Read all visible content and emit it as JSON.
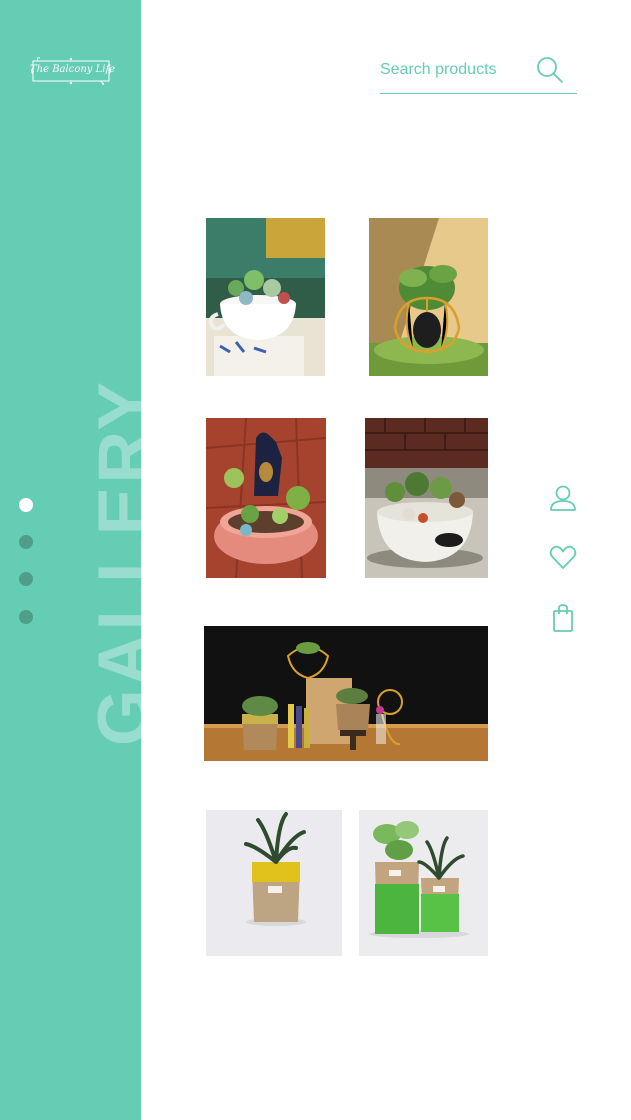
{
  "brand": {
    "logo_text": "The Balcony Life"
  },
  "sidebar": {
    "gallery_label": "GALLERY",
    "pager": [
      {
        "state": "active"
      },
      {
        "state": "inactive"
      },
      {
        "state": "inactive"
      },
      {
        "state": "inactive"
      }
    ]
  },
  "search": {
    "placeholder": "Search products",
    "icon": "search-icon"
  },
  "side_icons": [
    "user-icon",
    "heart-icon",
    "shopping-bag-icon"
  ],
  "gallery": {
    "photos": [
      {
        "subject": "succulents in a white teacup on a book"
      },
      {
        "subject": "plant in a gold wire pot"
      },
      {
        "subject": "succulents in a pink bowl with figurine"
      },
      {
        "subject": "succulents in a white round planter"
      },
      {
        "subject": "plants in paper bags and wire pots on a shelf"
      },
      {
        "subject": "snake plant in yellow paper bag"
      },
      {
        "subject": "two plants in green paper bags"
      }
    ]
  },
  "colors": {
    "accent": "#66cdb5",
    "pager_inactive": "#4f9e8a",
    "background": "#ffffff"
  }
}
